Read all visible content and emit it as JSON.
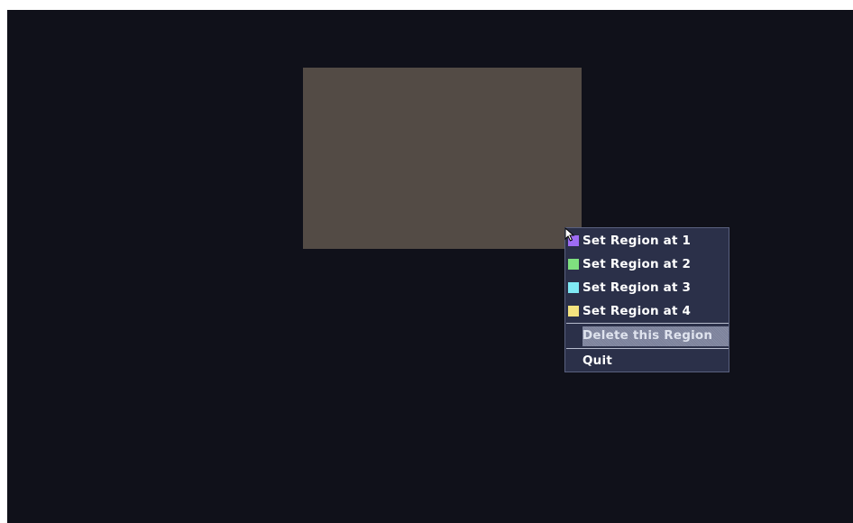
{
  "context_menu": {
    "items": [
      {
        "label": "Set Region at 1",
        "swatch_color": "#9e6cf4",
        "swatch_icon": "region-1-swatch-icon"
      },
      {
        "label": "Set Region at 2",
        "swatch_color": "#7fe07f",
        "swatch_icon": "region-2-swatch-icon"
      },
      {
        "label": "Set Region at 3",
        "swatch_color": "#7fe9f4",
        "swatch_icon": "region-3-swatch-icon"
      },
      {
        "label": "Set Region at 4",
        "swatch_color": "#f4e37f",
        "swatch_icon": "region-4-swatch-icon"
      }
    ],
    "delete_label": "Delete this Region",
    "quit_label": "Quit"
  },
  "colors": {
    "background": "#10111a",
    "region": "#534b45",
    "menu_background": "#2b3049",
    "menu_highlight": "#7a809a"
  },
  "icons": {
    "cursor": "mouse-pointer-icon"
  }
}
